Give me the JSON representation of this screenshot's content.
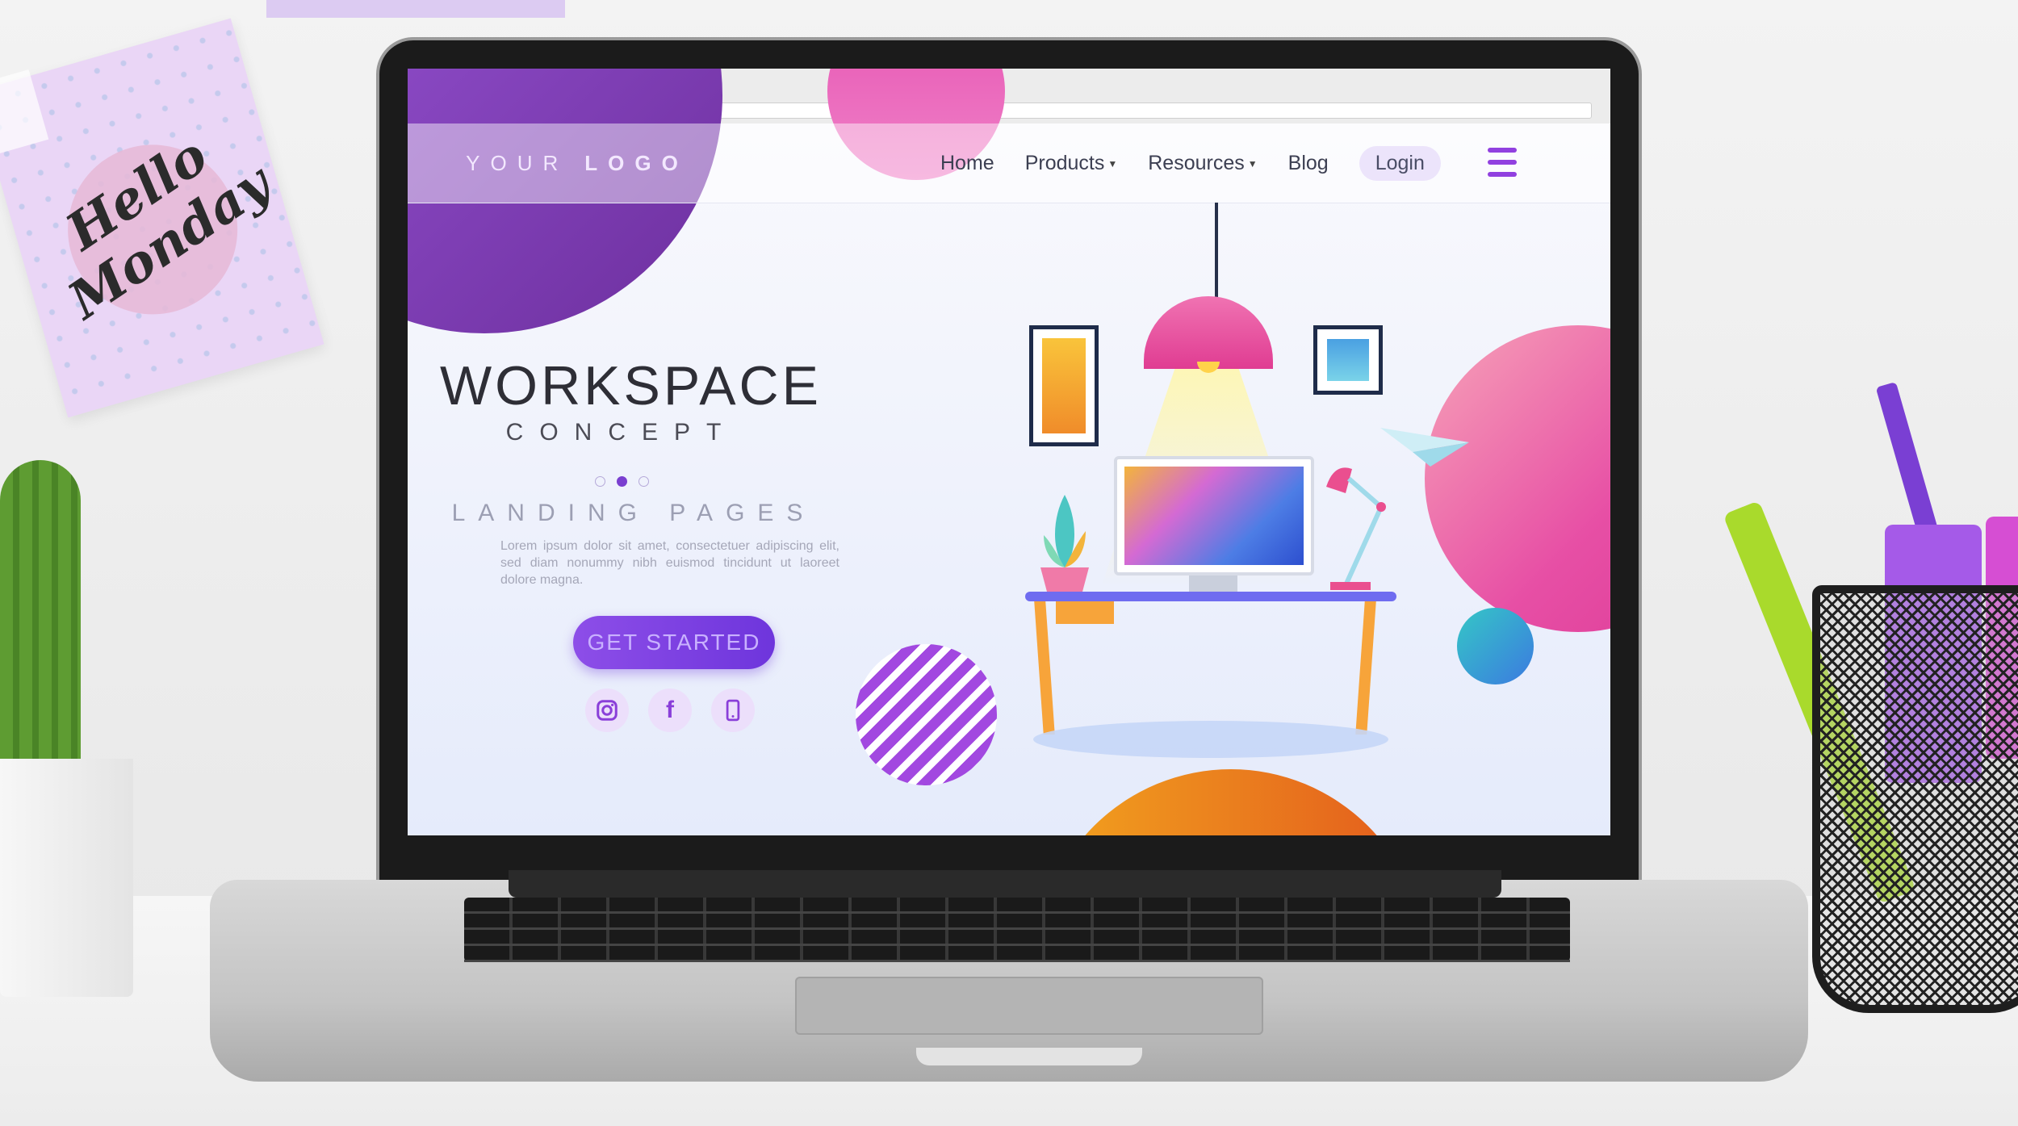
{
  "browser": {
    "window_dots": "●●●",
    "nav_arrows": "← → ⟳ ⌂"
  },
  "site": {
    "logo": {
      "word1": "YOUR",
      "word2": "LOGO"
    },
    "nav": [
      {
        "label": "Home",
        "dropdown": false
      },
      {
        "label": "Products",
        "dropdown": true
      },
      {
        "label": "Resources",
        "dropdown": true
      },
      {
        "label": "Blog",
        "dropdown": false
      }
    ],
    "login": "Login",
    "menu_icon": "hamburger-menu-icon"
  },
  "hero": {
    "title": "WORKSPACE",
    "subtitle": "CONCEPT",
    "tagline": "LANDING PAGES",
    "body": "Lorem ipsum dolor sit amet, consectetuer adipiscing elit, sed diam nonummy nibh euismod tincidunt ut laoreet dolore magna.",
    "cta": "GET STARTED",
    "carousel": {
      "count": 3,
      "active": 2
    },
    "social": [
      "instagram-icon",
      "facebook-icon",
      "mobile-icon"
    ]
  },
  "sticky_note": {
    "text_line1": "Hello",
    "text_line2": "Monday"
  },
  "colors": {
    "accent_purple": "#7a3fd0",
    "brand_pink": "#e74fa5",
    "orange": "#f2a41e",
    "teal": "#35c7c6"
  }
}
